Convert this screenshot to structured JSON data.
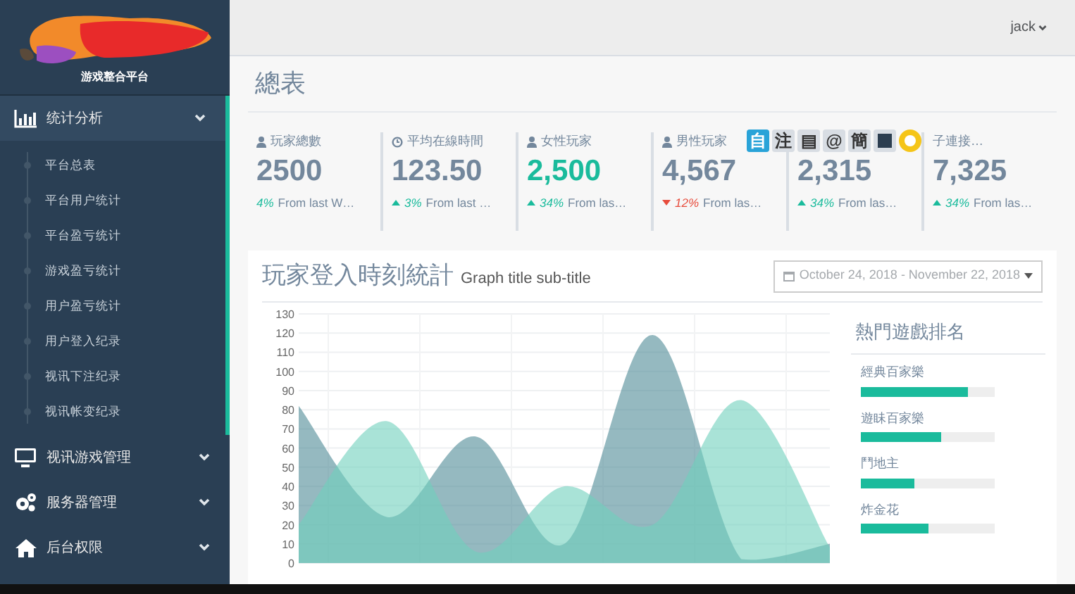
{
  "sidebar": {
    "brand": "游戏整合平台",
    "menu": [
      {
        "label": "统计分析",
        "kind": "chart",
        "expanded": true,
        "children": [
          "平台总表",
          "平台用户统计",
          "平台盈亏统计",
          "游戏盈亏统计",
          "用户盈亏统计",
          "用户登入纪录",
          "视讯下注纪录",
          "视讯帐变纪录"
        ]
      },
      {
        "label": "视讯游戏管理",
        "kind": "monitor",
        "expanded": false
      },
      {
        "label": "服务器管理",
        "kind": "gears",
        "expanded": false
      },
      {
        "label": "后台权限",
        "kind": "home",
        "expanded": false
      }
    ]
  },
  "topbar": {
    "user": "jack"
  },
  "page_title": "總表",
  "stats": [
    {
      "icon": {
        "kind": "user"
      },
      "label": "玩家總數",
      "value": "2500",
      "highlight": false,
      "change": {
        "kind": "none",
        "percent": "4%",
        "note": "From last W…"
      }
    },
    {
      "icon": {
        "kind": "clock"
      },
      "label": "平均在線時間",
      "value": "123.50",
      "highlight": false,
      "change": {
        "kind": "up",
        "percent": "3%",
        "note": "From last …"
      }
    },
    {
      "icon": {
        "kind": "user"
      },
      "label": "女性玩家",
      "value": "2,500",
      "highlight": true,
      "change": {
        "kind": "up",
        "percent": "34%",
        "note": "From las…"
      }
    },
    {
      "icon": {
        "kind": "user"
      },
      "label": "男性玩家",
      "value": "4,567",
      "highlight": false,
      "change": {
        "kind": "down",
        "percent": "12%",
        "note": "From las…"
      }
    },
    {
      "value": "2,315",
      "highlight": false,
      "change": {
        "kind": "up",
        "percent": "34%",
        "note": "From las…"
      }
    },
    {
      "label": "子連接…",
      "value": "7,325",
      "highlight": false,
      "change": {
        "kind": "up",
        "percent": "34%",
        "note": "From las…"
      }
    }
  ],
  "overlay_toolbar": [
    "自",
    "注",
    "▤",
    "@",
    "簡"
  ],
  "chart_panel": {
    "title": "玩家登入時刻統計",
    "subtitle": "Graph title sub-title",
    "date_range": "October 24, 2018 - November 22, 2018",
    "chart_data": {
      "type": "area",
      "grid": true,
      "ylim": [
        0,
        130
      ],
      "yticks": [
        0,
        10,
        20,
        30,
        40,
        50,
        60,
        70,
        80,
        90,
        100,
        110,
        120,
        130
      ],
      "series": [
        {
          "color": "#4f8a96",
          "values": [
            82,
            24,
            66,
            10,
            119,
            2,
            10
          ]
        },
        {
          "color": "#6fd1bd",
          "values": [
            20,
            74,
            6,
            40,
            20,
            85,
            8
          ]
        }
      ]
    }
  },
  "ranking": {
    "title": "熱門遊戲排名",
    "items": [
      {
        "name": "經典百家樂",
        "level": 0.8
      },
      {
        "name": "遊眛百家樂",
        "level": 0.6
      },
      {
        "name": "鬥地主",
        "level": 0.4
      },
      {
        "name": "炸金花",
        "level": 0.5
      }
    ]
  }
}
